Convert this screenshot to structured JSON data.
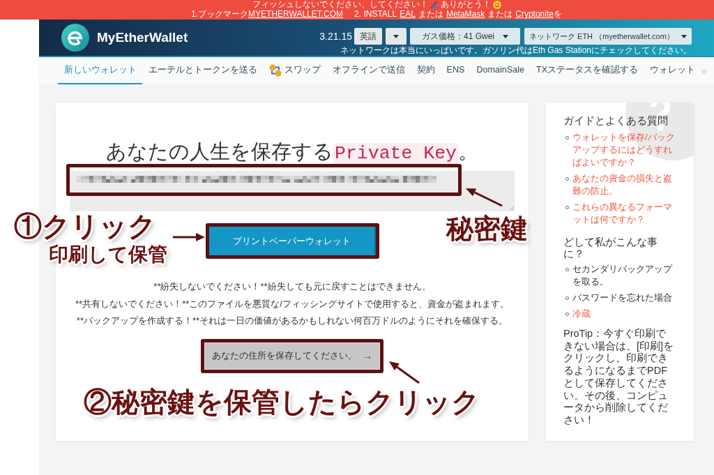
{
  "banner": {
    "notice": [
      "フィッシュしないでください、してください！",
      "ありがとう！"
    ],
    "bookmark_line": {
      "steps": [
        [
          [
            {
              "text": "1.ブックマーク",
              "link": false
            },
            {
              "text": "MYETHERWALLET.COM",
              "link": true
            }
          ]
        ],
        [
          [
            {
              "text": "2. INSTALL",
              "link": false
            }
          ],
          [
            {
              "text": "EAL",
              "link": true
            }
          ],
          [
            {
              "text": "または",
              "link": false
            }
          ],
          [
            {
              "text": "MetaMask",
              "link": true
            }
          ],
          [
            {
              "text": "または",
              "link": false
            }
          ],
          [
            {
              "text": "Cryptonite",
              "link": true
            },
            {
              "text": "を",
              "link": false
            }
          ]
        ]
      ]
    }
  },
  "header": {
    "brand": "MyEtherWallet",
    "version": "3.21.15",
    "language": "英語",
    "gas": "ガス価格：41 Gwei",
    "network": "ネットワーク ETH （myetherwallet.com）",
    "notice": "ネットワークは本当にいっぱいです。ガソリン代はEth Gas Stationにチェックしてください。"
  },
  "nav": {
    "tabs": [
      {
        "label": "新しいウォレット",
        "selected": true,
        "kind": "text"
      },
      {
        "label": "エーテルとトークンを送る",
        "selected": false,
        "kind": "text"
      },
      {
        "label": "スワップ",
        "selected": false,
        "kind": "icon"
      },
      {
        "label": "オフラインで送信",
        "selected": false,
        "kind": "text"
      },
      {
        "label": "契約",
        "selected": false,
        "kind": "text"
      },
      {
        "label": "ENS",
        "selected": false,
        "kind": "text"
      },
      {
        "label": "DomainSale",
        "selected": false,
        "kind": "text"
      },
      {
        "label": "TXステータスを確認する",
        "selected": false,
        "kind": "text"
      },
      {
        "label": "ウォレット",
        "selected": false,
        "kind": "text"
      }
    ],
    "scroll": "»"
  },
  "main": {
    "heading": {
      "text": "あなたの人生を保存する",
      "code": "Private Key",
      "end": "。"
    },
    "print_button": "プリントペーパーウォレット",
    "warnings": [
      "**紛失しないでください！**紛失しても元に戻すことはできません。",
      "**共有しないでください！**このファイルを悪質な/フィッシングサイトで使用すると、資金が盗まれます。",
      "**バックアップを作成する！**それは一日の価値があるかもしれない何百万ドルのようにそれを確保する。"
    ],
    "save_button": {
      "label": "あなたの住所を保存してください。",
      "arrow": "→"
    }
  },
  "sidebar": {
    "sections": [
      {
        "heading": "ガイドとよくある質問",
        "items": [
          {
            "text": "ウォレットを保存/バックアップするにはどうすればよいですか？",
            "link": true
          },
          {
            "text": "あなたの資金の損失と盗難の防止。",
            "link": true
          },
          {
            "text": "これらの異なるフォーマットは何ですか？",
            "link": true
          }
        ]
      },
      {
        "heading": "どして私がこんな事に？",
        "items": [
          {
            "text": "セカンダリバックアップを取る。",
            "link": false
          },
          {
            "text": "パスワードを忘れた場合",
            "link": false
          },
          {
            "text": "冷蔵",
            "link": true
          }
        ]
      }
    ],
    "protip": "ProTip：今すぐ印刷できない場合は、[印刷]をクリックし、印刷できるようになるまでPDFとして保存してください。その後、コンピュータから削除してください！"
  },
  "annotations": {
    "step_1": "①クリック",
    "step_1_note": "印刷して保管",
    "key_label": "秘密鍵",
    "step_2": "②秘密鍵を保管したらクリック"
  }
}
